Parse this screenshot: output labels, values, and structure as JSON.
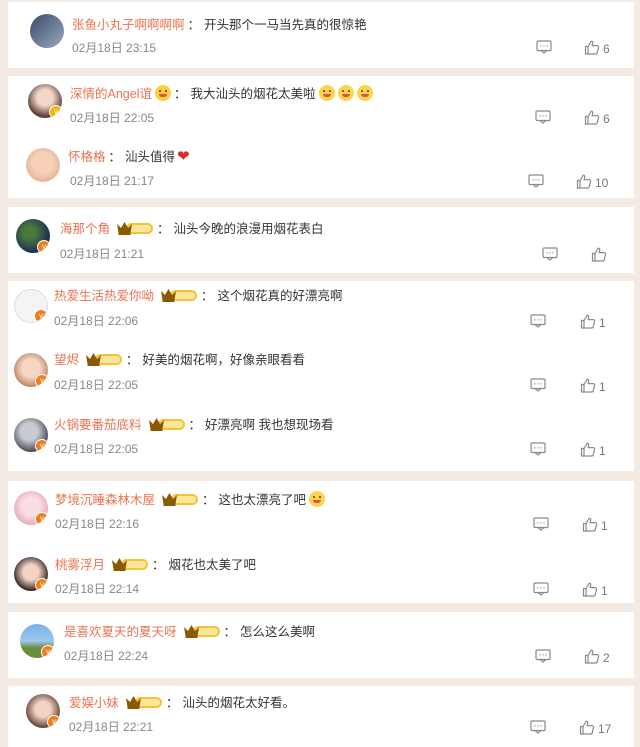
{
  "comments": [
    {
      "user": "张鱼小丸子啊啊啊啊",
      "text": "开头那个一马当先真的很惊艳",
      "time": "02月18日 23:15",
      "likes": "6",
      "badge": ""
    },
    {
      "user": "深情的Angel谊",
      "text": "我大汕头的烟花太美啦",
      "time": "02月18日 22:05",
      "likes": "6",
      "badge": "crown"
    },
    {
      "user": "怀格格",
      "text": "汕头值得",
      "time": "02月18日 21:17",
      "likes": "10",
      "badge": ""
    },
    {
      "user": "海那个角",
      "text": "汕头今晚的浪漫用烟花表白",
      "time": "02月18日 21:21",
      "likes": "",
      "badge": "II"
    },
    {
      "user": "热爱生活热爱你呦",
      "text": "这个烟花真的好漂亮啊",
      "time": "02月18日 22:06",
      "likes": "1",
      "badge": "I"
    },
    {
      "user": "望烬",
      "text": "好美的烟花啊，好像亲眼看看",
      "time": "02月18日 22:05",
      "likes": "1",
      "badge": "III"
    },
    {
      "user": "火锅要番茄底料",
      "text": "好漂亮啊 我也想现场看",
      "time": "02月18日 22:05",
      "likes": "1",
      "badge": "I"
    },
    {
      "user": "梦境沉睡森林木屋",
      "text": "这也太漂亮了吧",
      "time": "02月18日 22:16",
      "likes": "1",
      "badge": "I"
    },
    {
      "user": "桃雾浮月",
      "text": "烟花也太美了吧",
      "time": "02月18日 22:14",
      "likes": "1",
      "badge": "I"
    },
    {
      "user": "是喜欢夏天的夏天呀",
      "text": "怎么这么美啊",
      "time": "02月18日 22:24",
      "likes": "2",
      "badge": "II"
    },
    {
      "user": "爱娱小妹",
      "text": "汕头的烟花太好看。",
      "time": "02月18日 22:21",
      "likes": "17",
      "badge": "II"
    }
  ],
  "colors": {
    "name": "#eb7350",
    "background": "#f3ebe3",
    "verified": "#f07d1a"
  },
  "icons": {
    "reply": "comment-icon",
    "like": "thumbs-up-icon"
  }
}
